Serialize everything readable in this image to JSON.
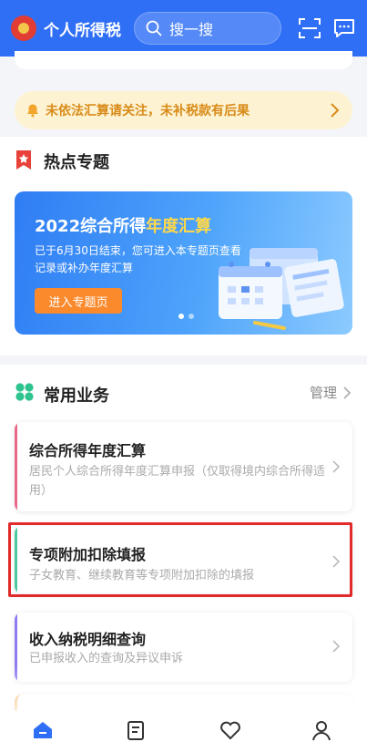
{
  "header": {
    "app_title": "个人所得税",
    "search_placeholder": "搜一搜",
    "icons": [
      "emblem-logo",
      "search-icon",
      "scan-icon",
      "message-icon"
    ],
    "bg_color": "#2f6ff6"
  },
  "notice": {
    "text": "未依法汇算请关注，未补税款有后果",
    "icon": "bell-icon"
  },
  "hot_topics": {
    "title": "热点专题",
    "banner": {
      "title_prefix": "2022综合所得",
      "title_highlight": "年度汇算",
      "subtitle": "已于6月30日结束，您可进入本专题页查看记录或补办年度汇算",
      "button": "进入专题页"
    }
  },
  "common_services": {
    "title": "常用业务",
    "manage_label": "管理",
    "items": [
      {
        "title": "综合所得年度汇算",
        "desc": "居民个人综合所得年度汇算申报（仅取得境内综合所得适用）",
        "color": "#e86a8a"
      },
      {
        "title": "专项附加扣除填报",
        "desc": "子女教育、继续教育等专项附加扣除的填报",
        "color": "#4cc9a0"
      },
      {
        "title": "收入纳税明细查询",
        "desc": "已申报收入的查询及异议申诉",
        "color": "#8c7cf0"
      }
    ]
  },
  "nav": {
    "icons": [
      "home-icon",
      "service-icon",
      "heart-icon",
      "profile-icon"
    ],
    "active_color": "#2f6ff6"
  }
}
